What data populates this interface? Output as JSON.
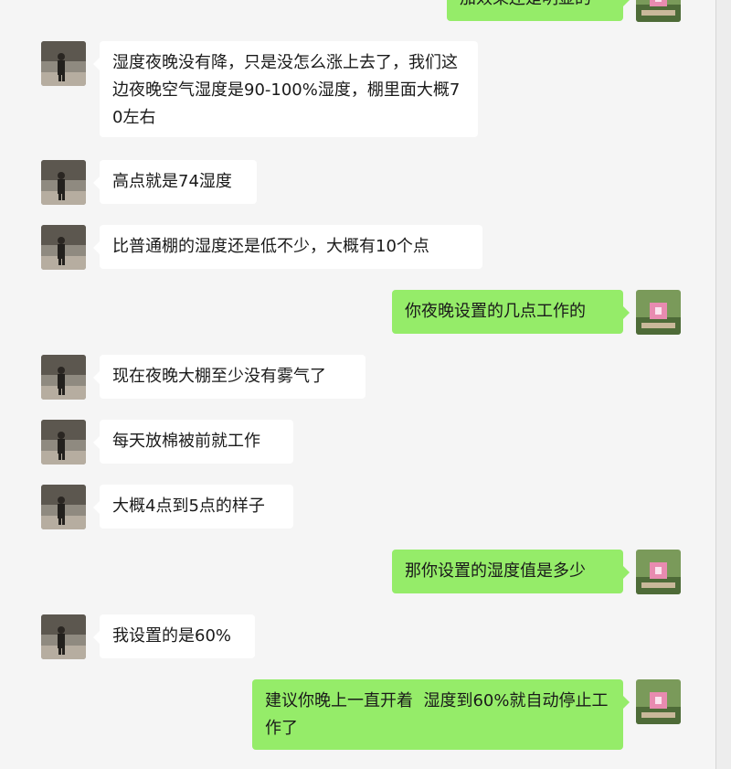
{
  "messages": [
    {
      "id": "m0",
      "side": "right",
      "text": "加效果还是明显的",
      "avatar": "flower-cart-avatar"
    },
    {
      "id": "m1",
      "side": "left",
      "text": "湿度夜晚没有降，只是没怎么涨上去了，我们这边夜晚空气湿度是90-100%湿度，棚里面大概70左右",
      "avatar": "person-walking-avatar"
    },
    {
      "id": "m2",
      "side": "left",
      "text": "高点就是74湿度",
      "avatar": "person-walking-avatar"
    },
    {
      "id": "m3",
      "side": "left",
      "text": "比普通棚的湿度还是低不少，大概有10个点",
      "avatar": "person-walking-avatar"
    },
    {
      "id": "m4",
      "side": "right",
      "text": "你夜晚设置的几点工作的",
      "avatar": "flower-cart-avatar"
    },
    {
      "id": "m5",
      "side": "left",
      "text": "现在夜晚大棚至少没有雾气了",
      "avatar": "person-walking-avatar"
    },
    {
      "id": "m6",
      "side": "left",
      "text": "每天放棉被前就工作",
      "avatar": "person-walking-avatar"
    },
    {
      "id": "m7",
      "side": "left",
      "text": "大概4点到5点的样子",
      "avatar": "person-walking-avatar"
    },
    {
      "id": "m8",
      "side": "right",
      "text": "那你设置的湿度值是多少",
      "avatar": "flower-cart-avatar"
    },
    {
      "id": "m9",
      "side": "left",
      "text": "我设置的是60%",
      "avatar": "person-walking-avatar"
    },
    {
      "id": "m10",
      "side": "right",
      "text": "建议你晚上一直开着  湿度到60%就自动停止工作了",
      "avatar": "flower-cart-avatar"
    }
  ],
  "colors": {
    "background": "#f5f5f5",
    "incoming_bubble": "#ffffff",
    "outgoing_bubble": "#95ec69"
  }
}
